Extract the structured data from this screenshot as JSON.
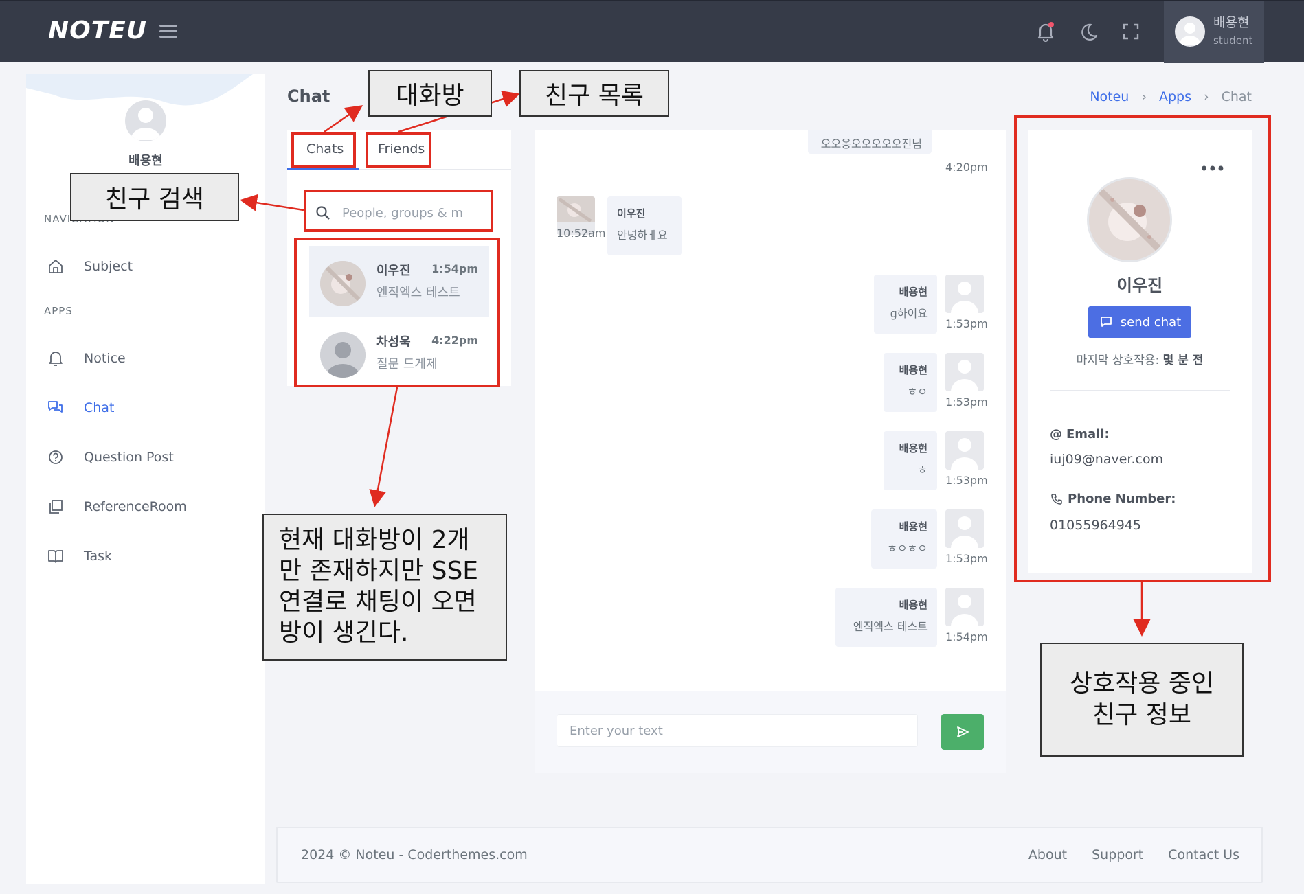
{
  "app": {
    "logo": "NOTEU",
    "user_name": "배용현",
    "user_role": "student"
  },
  "sidebar": {
    "profile_name": "배용현",
    "section_nav": "NAVIGATION",
    "section_apps": "APPS",
    "items": [
      {
        "label": "Subject",
        "icon": "home-icon"
      },
      {
        "label": "Notice",
        "icon": "bell-icon"
      },
      {
        "label": "Chat",
        "icon": "chat-icon",
        "active": true
      },
      {
        "label": "Question Post",
        "icon": "question-circle-icon"
      },
      {
        "label": "ReferenceRoom",
        "icon": "copy-icon"
      },
      {
        "label": "Task",
        "icon": "book-icon"
      }
    ]
  },
  "page": {
    "title": "Chat",
    "breadcrumb": [
      "Noteu",
      "Apps",
      "Chat"
    ]
  },
  "chat_list": {
    "tabs": [
      "Chats",
      "Friends"
    ],
    "search_placeholder": "People, groups & m",
    "items": [
      {
        "name": "이우진",
        "time": "1:54pm",
        "message": "엔직엑스 테스트"
      },
      {
        "name": "차성욱",
        "time": "4:22pm",
        "message": "질문 드게제"
      }
    ]
  },
  "conversation": {
    "messages": [
      {
        "side": "right",
        "name": "",
        "text": "오오옹오오오오오진님",
        "time": "4:20pm"
      },
      {
        "side": "left",
        "name": "이우진",
        "text": "안녕하ㅔ요",
        "time": "10:52am"
      },
      {
        "side": "right",
        "name": "배용현",
        "text": "g하이요",
        "time": "1:53pm"
      },
      {
        "side": "right",
        "name": "배용현",
        "text": "ㅎㅇ",
        "time": "1:53pm"
      },
      {
        "side": "right",
        "name": "배용현",
        "text": "ㅎ",
        "time": "1:53pm"
      },
      {
        "side": "right",
        "name": "배용현",
        "text": "ㅎㅇㅎㅇ",
        "time": "1:53pm"
      },
      {
        "side": "right",
        "name": "배용현",
        "text": "엔직엑스 테스트",
        "time": "1:54pm"
      }
    ],
    "input_placeholder": "Enter your text"
  },
  "profile": {
    "name": "이우진",
    "send_chat_label": "send chat",
    "last_interaction_label": "마지막 상호작용:",
    "last_interaction_value": "몇 분 전",
    "email_label": "Email:",
    "email": "iuj09@naver.com",
    "phone_label": "Phone Number:",
    "phone": "01055964945"
  },
  "footer": {
    "copyright": "2024 © Noteu - Coderthemes.com",
    "links": [
      "About",
      "Support",
      "Contact Us"
    ]
  },
  "annotations": {
    "chat_room": "대화방",
    "friend_list": "친구 목록",
    "friend_search": "친구 검색",
    "rooms_note": "현재 대화방이 2개만 존재하지만 SSE 연결로 채팅이 오면 방이 생긴다.",
    "profile_note": "상호작용 중인 친구 정보"
  },
  "colors": {
    "topbar": "#363b48",
    "accent": "#3e6ee8",
    "send_green": "#4caf6a",
    "annotation_red": "#e02b20"
  }
}
